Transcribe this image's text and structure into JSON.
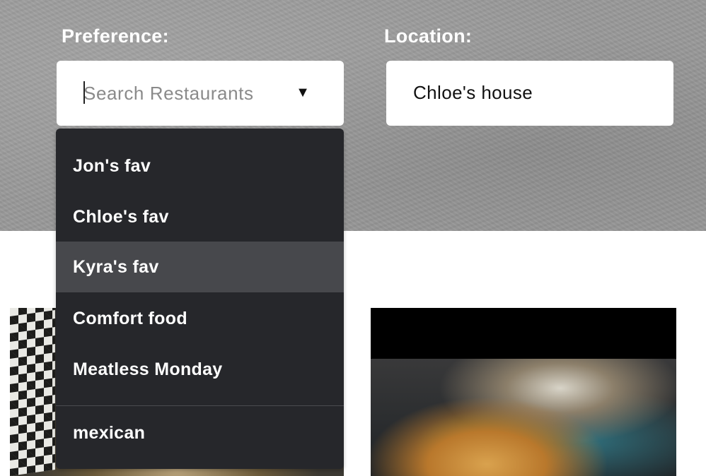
{
  "filters": {
    "preference_label": "Preference:",
    "location_label": "Location:",
    "search_placeholder": "Search Restaurants",
    "dropdown_arrow": "▼",
    "location_value": "Chloe's house"
  },
  "dropdown": {
    "items": [
      {
        "label": "Jon's fav"
      },
      {
        "label": "Chloe's fav"
      },
      {
        "label": "Kyra's fav",
        "highlighted": true
      },
      {
        "label": "Comfort food"
      },
      {
        "label": "Meatless Monday"
      },
      {
        "label": "mexican"
      }
    ]
  },
  "colors": {
    "hero_background": "#9a9a9a",
    "dropdown_background": "#26272b",
    "dropdown_highlight": "#47484c",
    "label_text": "#ffffff"
  },
  "icons": {
    "dropdown_arrow_icon": "caret-down-icon"
  }
}
